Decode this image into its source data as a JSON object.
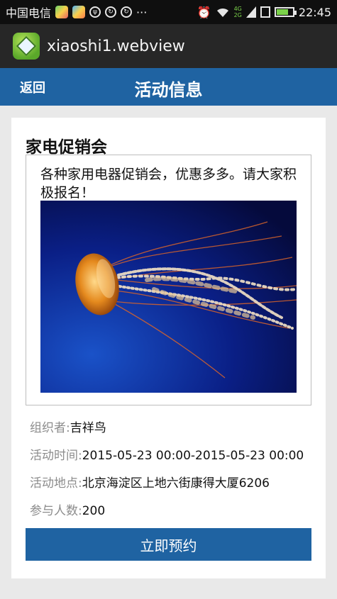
{
  "statusbar": {
    "carrier": "中国电信",
    "more": "···",
    "network_4g": "4G",
    "network_2g": "2G",
    "time": "22:45"
  },
  "appbar": {
    "title": "xiaoshi1.webview"
  },
  "header": {
    "back_label": "返回",
    "title": "活动信息",
    "color": "#1f63a2"
  },
  "event": {
    "title": "家电促销会",
    "description": "各种家用电器促销会，优惠多多。请大家积极报名！",
    "organizer_label": "组织者:",
    "organizer_value": "吉祥鸟",
    "time_label": "活动时间:",
    "time_value": "2015-05-23 00:00-2015-05-23 00:00",
    "location_label": "活动地点:",
    "location_value": "北京海淀区上地六街康得大厦6206",
    "participants_label": "参与人数:",
    "participants_value": "200",
    "reserve_label": "立即预约"
  }
}
